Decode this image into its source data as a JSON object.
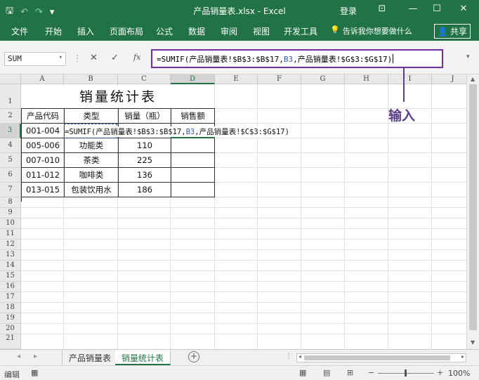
{
  "window": {
    "title": "产品销量表.xlsx  -  Excel",
    "login_label": "登录",
    "qat": {
      "save": "🖫",
      "undo": "↶",
      "redo": "↷",
      "more": "▾"
    },
    "controls": {
      "ribbon_display": "⊡",
      "minimize": "—",
      "maximize": "☐",
      "close": "✕"
    }
  },
  "ribbon": {
    "tabs": [
      "文件",
      "开始",
      "插入",
      "页面布局",
      "公式",
      "数据",
      "审阅",
      "视图",
      "开发工具"
    ],
    "tell_me": "告诉我你想要做什么",
    "tell_me_icon": "💡",
    "share_label": "共享",
    "share_icon": "👤"
  },
  "formula_bar": {
    "name_box": "SUM",
    "name_box_dropdown": "▾",
    "separator": "⋮",
    "cancel_icon": "✕",
    "enter_icon": "✓",
    "fx_icon": "fx",
    "formula_prefix": "=SUMIF(产品销量表!$B$3:$B$17,",
    "formula_ref": "B3",
    "formula_suffix": ",产品销量表!$G$3:$G$17)",
    "expand_icon": "▾"
  },
  "annotation": {
    "label": "输入",
    "color": "#5b3f8c"
  },
  "grid": {
    "columns": [
      "A",
      "B",
      "C",
      "D",
      "E",
      "F",
      "G",
      "H",
      "I",
      "J"
    ],
    "rows": [
      "1",
      "2",
      "3",
      "4",
      "5",
      "6",
      "7",
      "8",
      "9",
      "10",
      "11",
      "12",
      "13",
      "14",
      "15",
      "16",
      "17",
      "18",
      "19",
      "20",
      "21"
    ],
    "active_column": "D",
    "active_row": "3"
  },
  "sheet": {
    "title": "销量统计表",
    "headers": [
      "产品代码",
      "类型",
      "销量（瓶）",
      "销售额"
    ],
    "rows": [
      {
        "code": "001-004",
        "type": "",
        "qty": "",
        "amount": ""
      },
      {
        "code": "005-006",
        "type": "功能类",
        "qty": "110",
        "amount": ""
      },
      {
        "code": "007-010",
        "type": "茶类",
        "qty": "225",
        "amount": ""
      },
      {
        "code": "011-012",
        "type": "咖啡类",
        "qty": "136",
        "amount": ""
      },
      {
        "code": "013-015",
        "type": "包装饮用水",
        "qty": "186",
        "amount": ""
      }
    ],
    "editing_cell_prefix": "=SUMIF(产品销量表!$B$3:$B$17,",
    "editing_cell_ref": "B3",
    "editing_cell_suffix": ",产品销量表!$C$3:$G$17)"
  },
  "sheet_tabs": {
    "nav_prev": "◂",
    "nav_next": "▸",
    "tabs": [
      "产品销量表",
      "销量统计表"
    ],
    "active_index": 1,
    "add_icon": "+"
  },
  "status_bar": {
    "mode": "编辑",
    "macro_icon": "▦",
    "view_normal": "▦",
    "view_layout": "▤",
    "view_pagebreak": "⊞",
    "zoom_minus": "−",
    "zoom_plus": "+",
    "zoom": "100%"
  },
  "colors": {
    "accent": "#217346",
    "annotation": "#7030a0",
    "reference": "#2e59c4"
  }
}
